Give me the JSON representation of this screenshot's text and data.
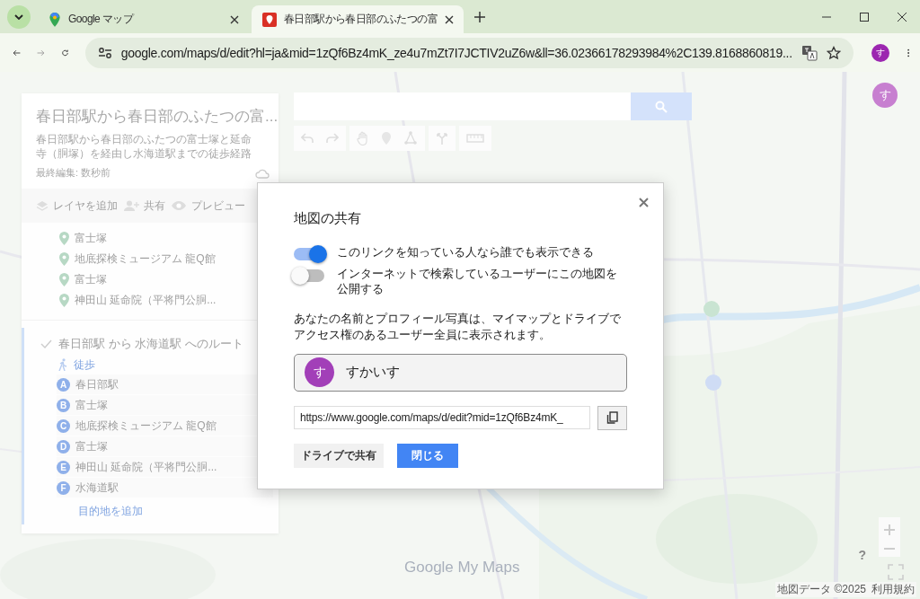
{
  "browser": {
    "tabs": [
      {
        "title": "Google マップ",
        "selected": false
      },
      {
        "title": "春日部駅から春日部のふたつの富",
        "selected": true
      }
    ],
    "address": "google.com/maps/d/edit?hl=ja&mid=1zQf6Bz4mK_ze4u7mZt7I7JCTIV2uZ6w&ll=36.02366178293984%2C139.8168860819...",
    "profile": "す"
  },
  "sidebar": {
    "title": "春日部駅から春日部のふたつの富...",
    "description": "春日部駅から春日部のふたつの富士塚と延命寺（胴塚）を経由し水海道駅までの徒歩経路",
    "last_edited": "最終編集: 数秒前",
    "actions": [
      "レイヤを追加",
      "共有",
      "プレビュー"
    ],
    "places": [
      "富士塚",
      "地底探検ミュージアム 龍Q館",
      "富士塚",
      "神田山 延命院（平将門公胴..."
    ],
    "route": {
      "title": "春日部駅 から 水海道駅 へのルート",
      "checked": true,
      "mode": "徒歩",
      "stops": [
        {
          "letter": "A",
          "name": "春日部駅"
        },
        {
          "letter": "B",
          "name": "富士塚"
        },
        {
          "letter": "C",
          "name": "地底探検ミュージアム 龍Q館"
        },
        {
          "letter": "D",
          "name": "富士塚"
        },
        {
          "letter": "E",
          "name": "神田山 延命院（平将門公胴..."
        },
        {
          "letter": "F",
          "name": "水海道駅"
        }
      ],
      "add_destination": "目的地を追加"
    }
  },
  "map": {
    "account": "す",
    "logo": "Google My Maps",
    "attribution": "地図データ ©2025",
    "terms": "利用規約",
    "help": "?"
  },
  "dialog": {
    "title": "地図の共有",
    "toggles": [
      {
        "label": "このリンクを知っている人なら誰でも表示できる",
        "on": true
      },
      {
        "label": "インターネットで検索しているユーザーにこの地図を公開する",
        "on": false
      }
    ],
    "note": "あなたの名前とプロフィール写真は、マイマップとドライブでアクセス権のあるユーザー全員に表示されます。",
    "user": {
      "avatar": "す",
      "name": "すかいす"
    },
    "link": "https://www.google.com/maps/d/edit?mid=1zQf6Bz4mK_",
    "buttons": [
      {
        "label": "ドライブで共有",
        "kind": "secondary"
      },
      {
        "label": "閉じる",
        "kind": "primary"
      }
    ]
  }
}
